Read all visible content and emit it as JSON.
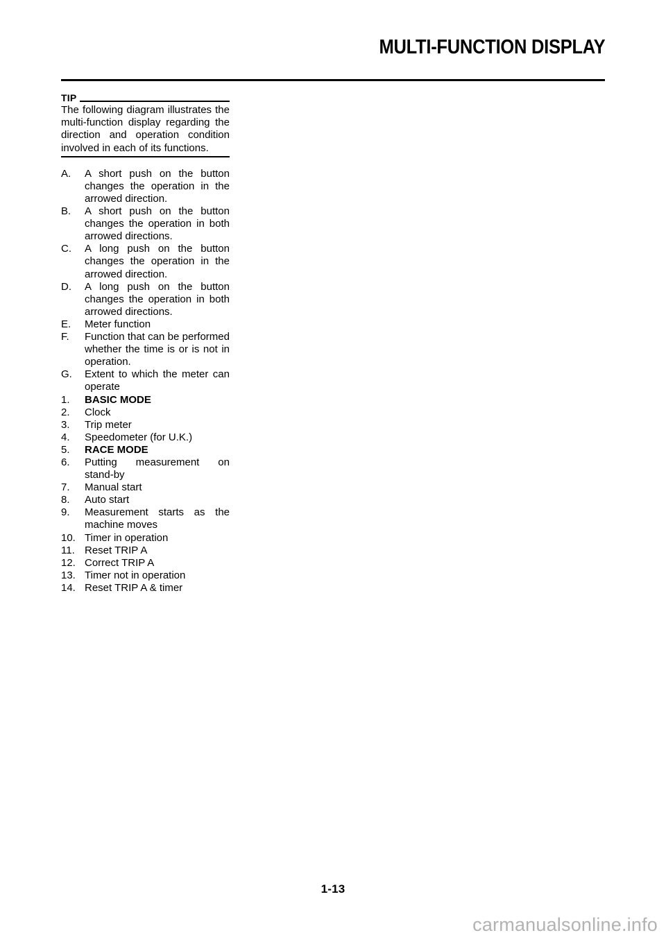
{
  "header": {
    "title": "MULTI-FUNCTION DISPLAY"
  },
  "tip": {
    "label": "TIP",
    "body": "The following diagram illustrates the multi-function display regarding the direction and operation condition involved in each of its functions."
  },
  "alpha_items": [
    {
      "marker": "A.",
      "text": "A short push on the button changes the operation in the arrowed direction.",
      "bold": false
    },
    {
      "marker": "B.",
      "text": "A short push on the button changes the operation in both arrowed directions.",
      "bold": false
    },
    {
      "marker": "C.",
      "text": "A long push on the button changes the operation in the arrowed direction.",
      "bold": false
    },
    {
      "marker": "D.",
      "text": "A long push on the button changes the operation in both arrowed directions.",
      "bold": false
    },
    {
      "marker": "E.",
      "text": "Meter function",
      "bold": false
    },
    {
      "marker": "F.",
      "text": "Function that can be performed whether the time is or is not in operation.",
      "bold": false
    },
    {
      "marker": "G.",
      "text": "Extent to which the meter can operate",
      "bold": false
    }
  ],
  "numbered_items": [
    {
      "marker": "1.",
      "text": "BASIC MODE",
      "bold": true
    },
    {
      "marker": "2.",
      "text": "Clock",
      "bold": false
    },
    {
      "marker": "3.",
      "text": "Trip meter",
      "bold": false
    },
    {
      "marker": "4.",
      "text": "Speedometer (for U.K.)",
      "bold": false
    },
    {
      "marker": "5.",
      "text": "RACE MODE",
      "bold": true
    },
    {
      "marker": "6.",
      "text": "Putting measurement on stand-by",
      "bold": false
    },
    {
      "marker": "7.",
      "text": "Manual start",
      "bold": false
    },
    {
      "marker": "8.",
      "text": "Auto start",
      "bold": false
    },
    {
      "marker": "9.",
      "text": "Measurement starts as the machine moves",
      "bold": false
    },
    {
      "marker": "10.",
      "text": "Timer in operation",
      "bold": false
    },
    {
      "marker": "11.",
      "text": "Reset TRIP A",
      "bold": false
    },
    {
      "marker": "12.",
      "text": "Correct TRIP A",
      "bold": false
    },
    {
      "marker": "13.",
      "text": "Timer not in operation",
      "bold": false
    },
    {
      "marker": "14.",
      "text": "Reset TRIP A & timer",
      "bold": false
    }
  ],
  "footer": {
    "page_number": "1-13",
    "watermark": "carmanualsonline.info"
  }
}
